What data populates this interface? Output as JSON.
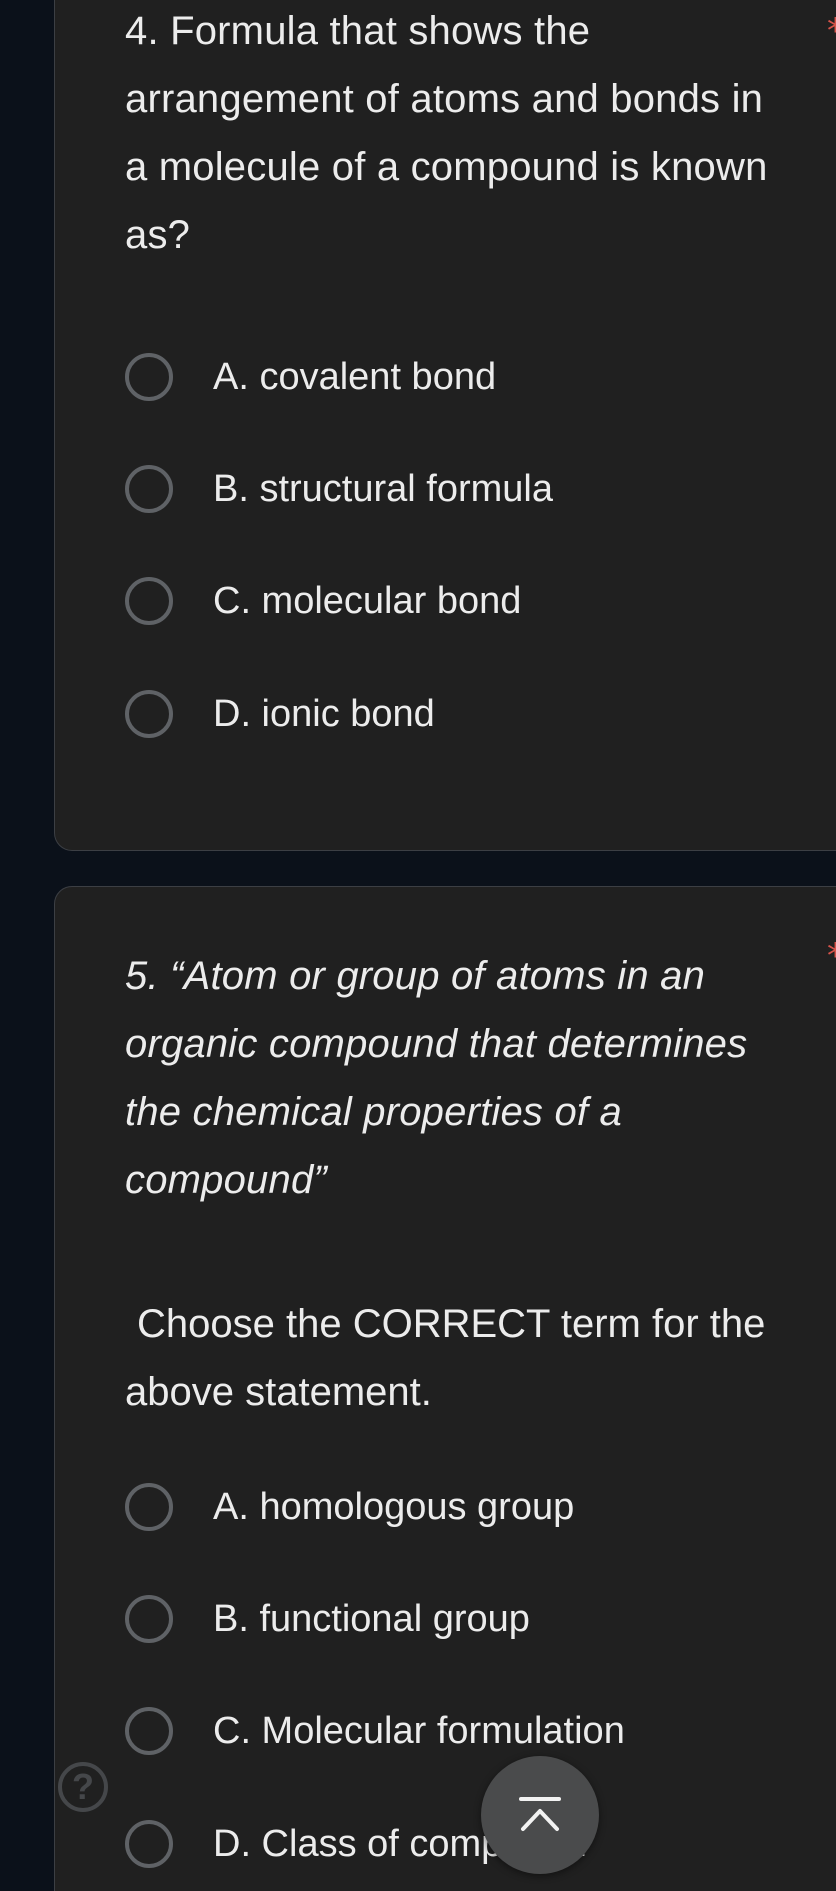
{
  "question4": {
    "text": "4. Formula that shows the arrangement of atoms and bonds in a molecule of a compound is known as?",
    "required_mark": "*",
    "options": [
      {
        "label": "A. covalent bond"
      },
      {
        "label": "B. structural formula"
      },
      {
        "label": "C. molecular bond"
      },
      {
        "label": "D. ionic bond"
      }
    ]
  },
  "question5": {
    "text": "5. “Atom or group of atoms in an organic compound that determines the chemical properties of a compound”",
    "instruction": "Choose the CORRECT term for the above statement.",
    "required_mark": "*",
    "options": [
      {
        "label": "A. homologous group"
      },
      {
        "label": "B. functional group"
      },
      {
        "label": "C. Molecular formulation"
      },
      {
        "label": "D. Class of compound"
      }
    ]
  },
  "controls": {
    "help_icon": "?",
    "scroll_top_icon": "chevron-up-icon"
  },
  "colors": {
    "background": "#0b111a",
    "card": "#202020",
    "text": "#ececec",
    "required": "#d7534a",
    "radio_border": "#5f6266"
  }
}
